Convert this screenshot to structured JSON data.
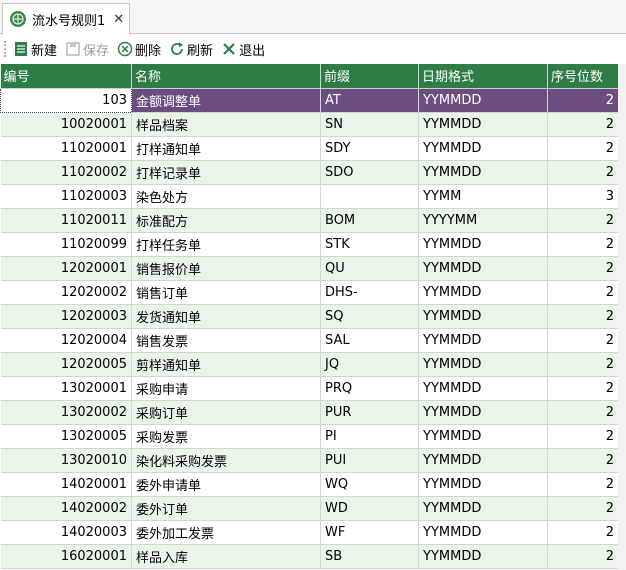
{
  "tab": {
    "title": "流水号规则1",
    "close": "✕"
  },
  "toolbar": {
    "new_label": "新建",
    "save_label": "保存",
    "delete_label": "删除",
    "refresh_label": "刷新",
    "exit_label": "退出"
  },
  "columns": [
    "编号",
    "名称",
    "前缀",
    "日期格式",
    "序号位数"
  ],
  "rows": [
    [
      "103",
      "金额调整单",
      "AT",
      "YYMMDD",
      "2"
    ],
    [
      "10020001",
      "样品档案",
      "SN",
      "YYMMDD",
      "2"
    ],
    [
      "11020001",
      "打样通知单",
      "SDY",
      "YYMMDD",
      "2"
    ],
    [
      "11020002",
      "打样记录单",
      "SDO",
      "YYMMDD",
      "2"
    ],
    [
      "11020003",
      "染色处方",
      "",
      "YYMM",
      "3"
    ],
    [
      "11020011",
      "标准配方",
      "BOM",
      "YYYYMM",
      "2"
    ],
    [
      "11020099",
      "打样任务单",
      "STK",
      "YYMMDD",
      "2"
    ],
    [
      "12020001",
      "销售报价单",
      "QU",
      "YYMMDD",
      "2"
    ],
    [
      "12020002",
      "销售订单",
      "DHS-",
      "YYMMDD",
      "2"
    ],
    [
      "12020003",
      "发货通知单",
      "SQ",
      "YYMMDD",
      "2"
    ],
    [
      "12020004",
      "销售发票",
      "SAL",
      "YYMMDD",
      "2"
    ],
    [
      "12020005",
      "剪样通知单",
      "JQ",
      "YYMMDD",
      "2"
    ],
    [
      "13020001",
      "采购申请",
      "PRQ",
      "YYMMDD",
      "2"
    ],
    [
      "13020002",
      "采购订单",
      "PUR",
      "YYMMDD",
      "2"
    ],
    [
      "13020005",
      "采购发票",
      "PI",
      "YYMMDD",
      "2"
    ],
    [
      "13020010",
      "染化料采购发票",
      "PUI",
      "YYMMDD",
      "2"
    ],
    [
      "14020001",
      "委外申请单",
      "WQ",
      "YYMMDD",
      "2"
    ],
    [
      "14020002",
      "委外订单",
      "WD",
      "YYMMDD",
      "2"
    ],
    [
      "14020003",
      "委外加工发票",
      "WF",
      "YYMMDD",
      "2"
    ],
    [
      "16020001",
      "样品入库",
      "SB",
      "YYMMDD",
      "2"
    ]
  ],
  "colors": {
    "header": "#2e7d46",
    "selected": "#6b4d7f",
    "alt_row": "#eaf5ea"
  }
}
